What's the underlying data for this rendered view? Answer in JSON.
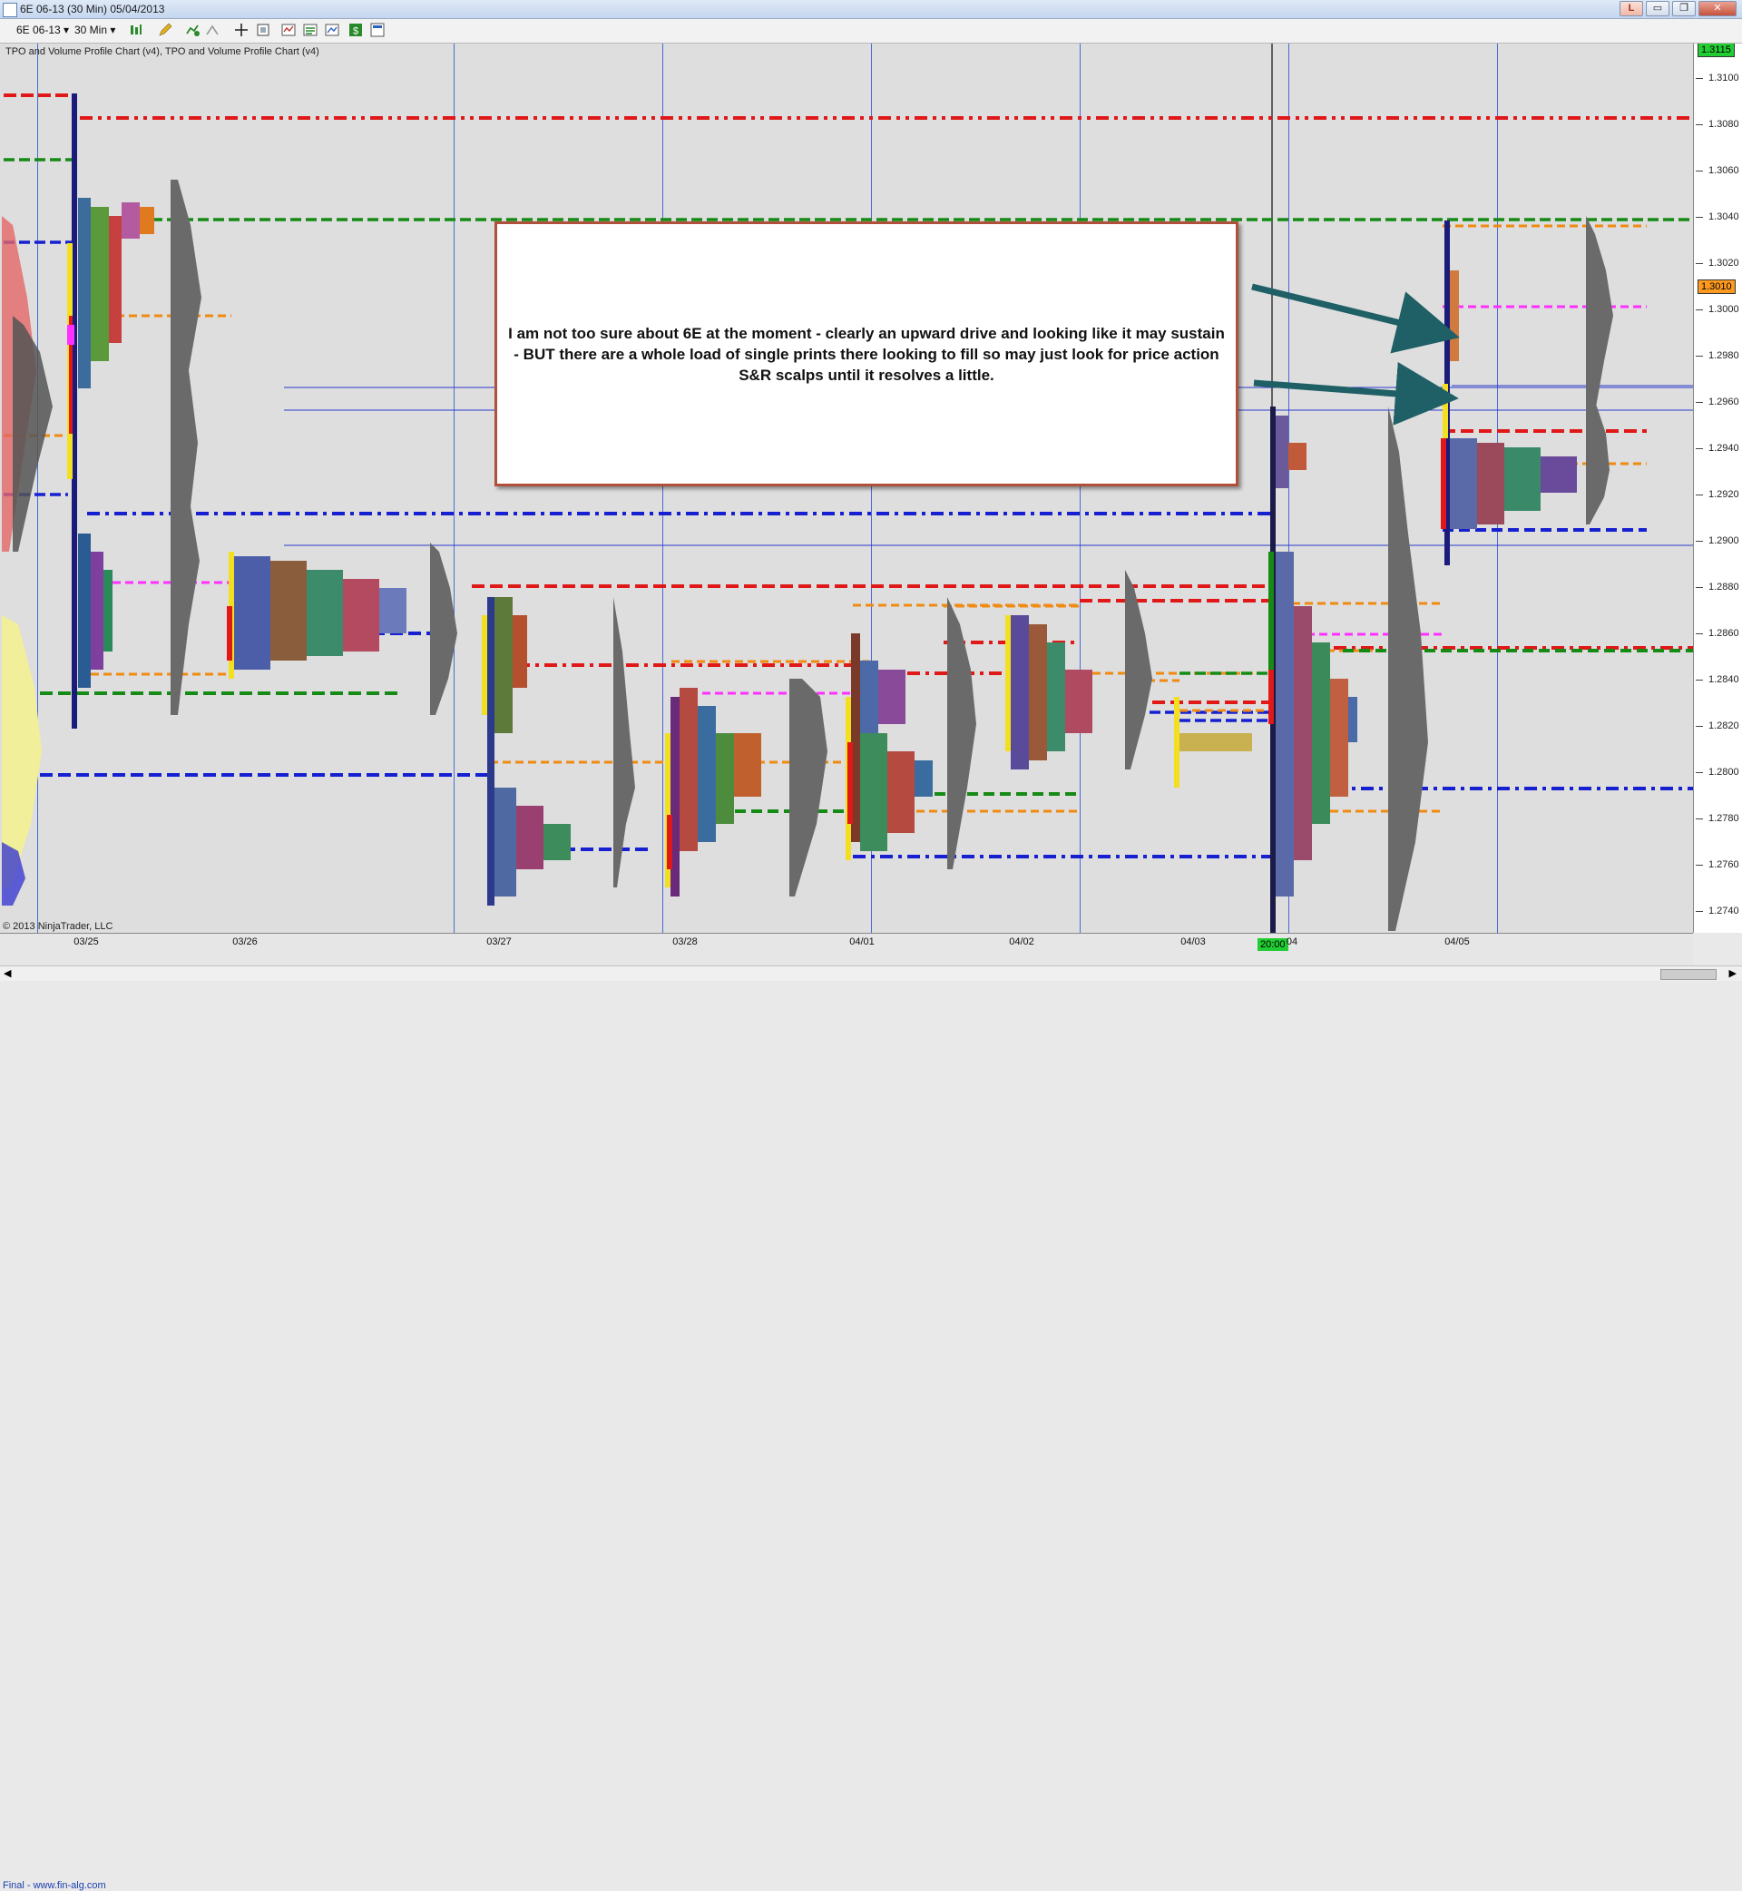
{
  "window": {
    "title": "6E 06-13 (30 Min)  05/04/2013",
    "buttons": {
      "link": "L",
      "minimize": "▭",
      "restore": "❐",
      "close": "✕"
    }
  },
  "toolbar": {
    "instrument": "6E 06-13",
    "interval": "30 Min",
    "dropdown_arrow": "▾"
  },
  "chart": {
    "indicator_label": "TPO and Volume Profile Chart (v4),  TPO and Volume Profile Chart (v4)",
    "copyright": "© 2013 NinjaTrader, LLC",
    "footer_link": "Final - www.fin-alg.com",
    "annotation": "I am not too sure about 6E at the moment - clearly an upward drive and looking like it may sustain - BUT there are a whole load of single prints there looking to fill so may just look for price action S&R scalps until it resolves a little.",
    "current_time": "20:00",
    "dates": [
      "03/25",
      "03/26",
      "03/27",
      "03/28",
      "04/01",
      "04/02",
      "04/03",
      "04",
      "04/05"
    ],
    "price_ticks": [
      "1.3100",
      "1.3080",
      "1.3060",
      "1.3040",
      "1.3020",
      "1.3000",
      "1.2980",
      "1.2960",
      "1.2940",
      "1.2920",
      "1.2900",
      "1.2880",
      "1.2860",
      "1.2840",
      "1.2820",
      "1.2800",
      "1.2780",
      "1.2760",
      "1.2740"
    ],
    "price_ticks_values": [
      1.31,
      1.308,
      1.306,
      1.304,
      1.302,
      1.3,
      1.298,
      1.296,
      1.294,
      1.292,
      1.29,
      1.288,
      1.286,
      1.284,
      1.282,
      1.28,
      1.278,
      1.276,
      1.274
    ],
    "top_price": "1.3115",
    "last_price": "1.3010",
    "top_price_value": 1.3115,
    "last_price_value": 1.301,
    "price_scale": {
      "top_value": 1.3115,
      "bottom_value": 1.27305
    },
    "colors": {
      "background": "#dedede",
      "grid_line": "#4a6ad8",
      "red_level": "#e01818",
      "green_level": "#158a15",
      "blue_level": "#1620d0",
      "orange_level": "#f08a10",
      "magenta_level": "#ff30ff",
      "profile_gray": "#6a6a6a",
      "arrow": "#1f5f66",
      "annotation_border": "#b0503a",
      "current_time_bg": "#22cc33",
      "top_price_bg": "#22cc33",
      "last_price_bg": "#ff9a20"
    }
  }
}
